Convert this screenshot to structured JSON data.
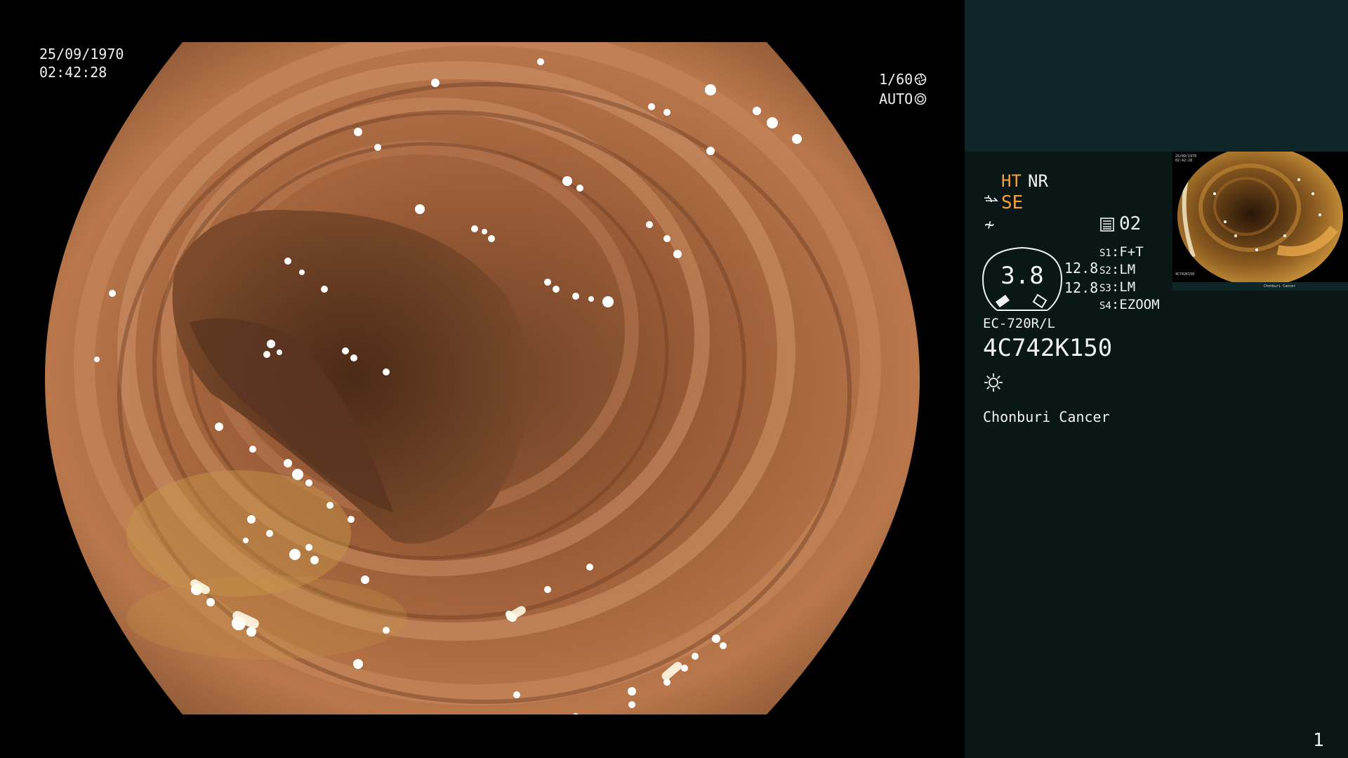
{
  "main_view": {
    "date": "25/09/1970",
    "time": "02:42:28",
    "shutter": "1/60",
    "shutter_icon": "aperture-icon",
    "exposure_mode": "AUTO",
    "exposure_icon": "ring-icon"
  },
  "panel": {
    "mode_ht": "HT",
    "mode_nr": "NR",
    "structure_enhancement": "SE",
    "se_icon": "wave-icon",
    "f_icon": "not-equal-icon",
    "channel": "02",
    "channel_icon": "memory-card-icon",
    "iris_value": "3.8",
    "readout_1": "12.8",
    "readout_2": "12.8",
    "switches": [
      {
        "key": "S1",
        "value": "F+T"
      },
      {
        "key": "S2",
        "value": "LM"
      },
      {
        "key": "S3",
        "value": "LM"
      },
      {
        "key": "S4",
        "value": "EZOOM"
      }
    ],
    "scope_model": "EC-720R/L",
    "scope_serial": "4C742K150",
    "light_icon": "sun-icon",
    "patient_label": "Chonburi Cancer",
    "page_number": "1"
  },
  "thumbnail": {
    "date": "25/09/1970",
    "time": "02:42:28",
    "serial": "4C742K150",
    "patient": "Chonburi Cancer"
  },
  "colors": {
    "panel_top": "#0f2628",
    "panel": "#0a1717",
    "accent_orange": "#f3a33a",
    "tissue": "#a8673f"
  }
}
